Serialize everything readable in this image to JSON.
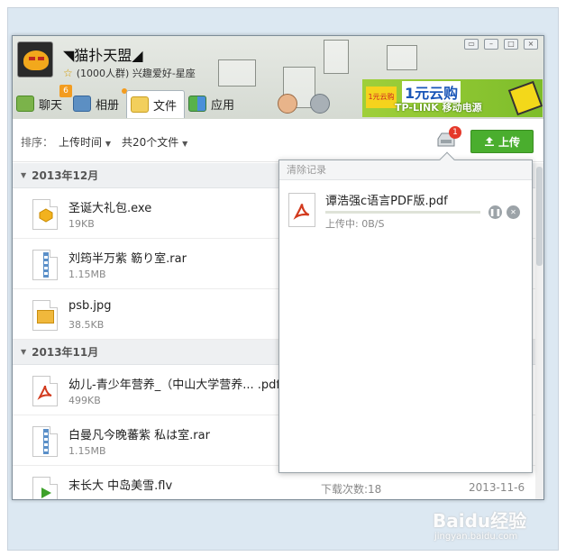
{
  "header": {
    "group_name": "◥猫扑天盟◢",
    "group_meta": "(1000人群) 兴趣爱好-星座",
    "tabs": [
      {
        "label": "聊天",
        "badge": "6"
      },
      {
        "label": "相册"
      },
      {
        "label": "文件"
      },
      {
        "label": "应用"
      }
    ]
  },
  "ad": {
    "tag": "1元云购",
    "title": "1元云购",
    "subtitle": "TP-LINK 移动电源"
  },
  "toolbar": {
    "sort_label": "排序：",
    "sort_value": "上传时间",
    "count_label": "共20个文件",
    "upload_label": "上传",
    "tray_badge": "1"
  },
  "groups": [
    {
      "title": "2013年12月",
      "files": [
        {
          "name": "圣诞大礼包.exe",
          "size": "19KB",
          "type": "exe"
        },
        {
          "name": "刘筠半万紫 簕り室.rar",
          "size": "1.15MB",
          "type": "rar"
        },
        {
          "name": "psb.jpg",
          "size": "38.5KB",
          "type": "jpg"
        }
      ]
    },
    {
      "title": "2013年11月",
      "files": [
        {
          "name": "幼儿-青少年营养_（中山大学营养... .pdf",
          "size": "499KB",
          "type": "pdf"
        },
        {
          "name": "白曼凡今晚蕃紫 私は室.rar",
          "size": "1.15MB",
          "type": "rar"
        },
        {
          "name": "末长大 中岛美雪.flv",
          "size": "",
          "type": "flv",
          "downloads": "下载次数:18",
          "date": "2013-11-6"
        }
      ]
    }
  ],
  "popup": {
    "clear_label": "清除记录",
    "item": {
      "name": "谭浩强c语言PDF版.pdf",
      "status": "上传中:  0B/S",
      "progress": 0.0
    }
  },
  "watermark": {
    "brand": "Baidu经验",
    "url": "jingyan.baidu.com"
  },
  "colors": {
    "upload_green": "#4aae2e",
    "badge_red": "#e5392b",
    "accent_orange": "#f39c1f"
  }
}
